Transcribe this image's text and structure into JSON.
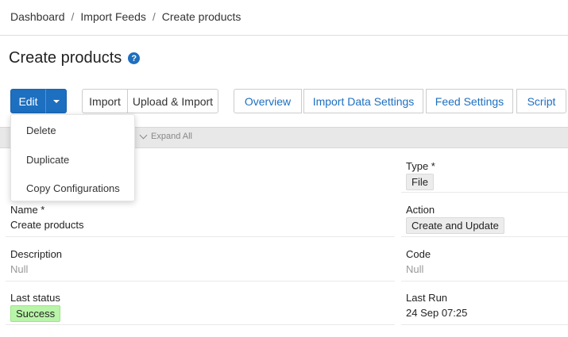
{
  "breadcrumb": {
    "items": [
      "Dashboard",
      "Import Feeds",
      "Create products"
    ],
    "sep": "/"
  },
  "page": {
    "title": "Create products",
    "help_glyph": "?"
  },
  "toolbar": {
    "edit": "Edit",
    "import": "Import",
    "upload_import": "Upload & Import",
    "overview": "Overview",
    "import_data_settings": "Import Data Settings",
    "feed_settings": "Feed Settings",
    "script": "Script"
  },
  "dropdown": {
    "items": [
      "Delete",
      "Duplicate",
      "Copy Configurations"
    ]
  },
  "panel": {
    "expand_all": "Expand All"
  },
  "fields": {
    "type": {
      "label": "Type *",
      "value": "File"
    },
    "name": {
      "label": "Name *",
      "value": "Create products"
    },
    "action": {
      "label": "Action",
      "value": "Create and Update"
    },
    "description": {
      "label": "Description",
      "value": "Null"
    },
    "code": {
      "label": "Code",
      "value": "Null"
    },
    "last_status": {
      "label": "Last status",
      "value": "Success"
    },
    "last_run": {
      "label": "Last Run",
      "value": "24 Sep 07:25"
    }
  },
  "colors": {
    "primary": "#1d6fc0",
    "success_bg": "#b9f5a8"
  }
}
